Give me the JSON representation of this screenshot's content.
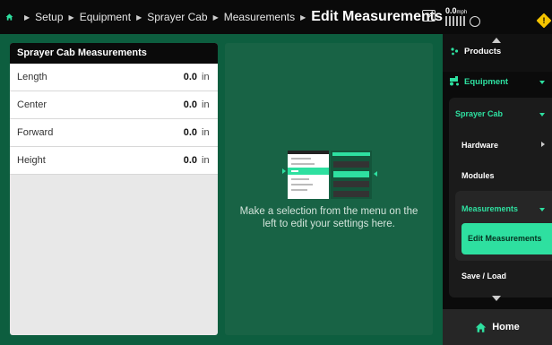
{
  "breadcrumb": {
    "home_icon": "home-icon",
    "items": [
      "Setup",
      "Equipment",
      "Sprayer Cab",
      "Measurements"
    ],
    "current": "Edit Measurements"
  },
  "status": {
    "speed_value": "0.0",
    "speed_unit": "mph"
  },
  "measurements": {
    "title": "Sprayer Cab Measurements",
    "rows": [
      {
        "label": "Length",
        "value": "0.0",
        "unit": "in"
      },
      {
        "label": "Center",
        "value": "0.0",
        "unit": "in"
      },
      {
        "label": "Forward",
        "value": "0.0",
        "unit": "in"
      },
      {
        "label": "Height",
        "value": "0.0",
        "unit": "in"
      }
    ]
  },
  "placeholder": {
    "text": "Make a selection from the menu on the left to edit your settings here."
  },
  "nav": {
    "products": "Products",
    "equipment": "Equipment",
    "sprayer_cab": "Sprayer Cab",
    "hardware": "Hardware",
    "modules": "Modules",
    "measurements": "Measurements",
    "edit_measurements": "Edit Measurements",
    "save_load": "Save / Load",
    "home": "Home"
  },
  "colors": {
    "accent": "#2ee0a0",
    "background": "#0d5e3f",
    "warning": "#f5c400"
  }
}
